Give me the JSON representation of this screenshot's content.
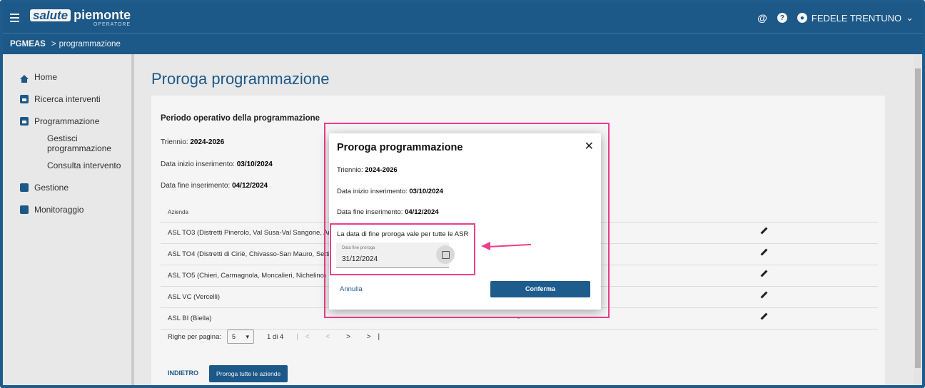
{
  "header": {
    "logo_box": "salute",
    "logo_text": "piemonte",
    "logo_sub": "OPERATORE",
    "at_icon": "@",
    "help_icon": "?",
    "user_name": "FEDELE TRENTUNO",
    "user_caret": "⌄"
  },
  "breadcrumb": {
    "app": "PGMEAS",
    "separator": ">",
    "page": "programmazione"
  },
  "sidebar": {
    "items": [
      {
        "label": "Home",
        "icon": "home-icon"
      },
      {
        "label": "Ricerca interventi",
        "icon": "calendar-icon"
      },
      {
        "label": "Programmazione",
        "icon": "calendar-icon"
      },
      {
        "label": "Gestisci programmazione"
      },
      {
        "label": "Consulta intervento"
      },
      {
        "label": "Gestione",
        "icon": "gear-icon"
      },
      {
        "label": "Monitoraggio",
        "icon": "chart-icon"
      }
    ]
  },
  "main": {
    "title": "Proroga programmazione",
    "section_title": "Periodo operativo della programmazione",
    "triennio_label": "Triennio:",
    "triennio_value": "2024-2026",
    "inizio_label": "Data inizio inserimento:",
    "inizio_value": "03/10/2024",
    "fine_label": "Data fine inserimento:",
    "fine_value": "04/12/2024",
    "table_header": "Azienda",
    "rows": [
      "ASL TO3 (Distretti Pinerolo, Val Susa-Val Sangone, Are",
      "ASL TO4 (Distretti di Ciriè, Chivasso-San Mauro, Settimo",
      "ASL TO5 (Chieri, Carmagnola, Moncalieri, Nichelino)",
      "ASL VC (Vercelli)",
      "ASL BI (Biella)"
    ],
    "last_row_dash": "-",
    "pager_label": "Righe per pagina:",
    "pager_value": "5",
    "pager_caret": "▾",
    "pager_range": "1 di 4",
    "pager_first": "|<",
    "pager_prev": "<",
    "pager_next": ">",
    "pager_last": ">|",
    "back_label": "INDIETRO",
    "proroga_all_label": "Proroga tutte le aziende"
  },
  "modal": {
    "title": "Proroga programmazione",
    "close": "✕",
    "triennio_label": "Triennio:",
    "triennio_value": "2024-2026",
    "inizio_label": "Data inizio inserimento:",
    "inizio_value": "03/10/2024",
    "fine_label": "Data fine inserimento:",
    "fine_value": "04/12/2024",
    "note": "La data di fine proroga vale per tutte le ASR",
    "field_label": "Data fine proroga",
    "field_value": "31/12/2024",
    "cancel_label": "Annulla",
    "confirm_label": "Conferma"
  },
  "colors": {
    "primary": "#1e5c8e",
    "highlight": "#ee3c8e"
  }
}
